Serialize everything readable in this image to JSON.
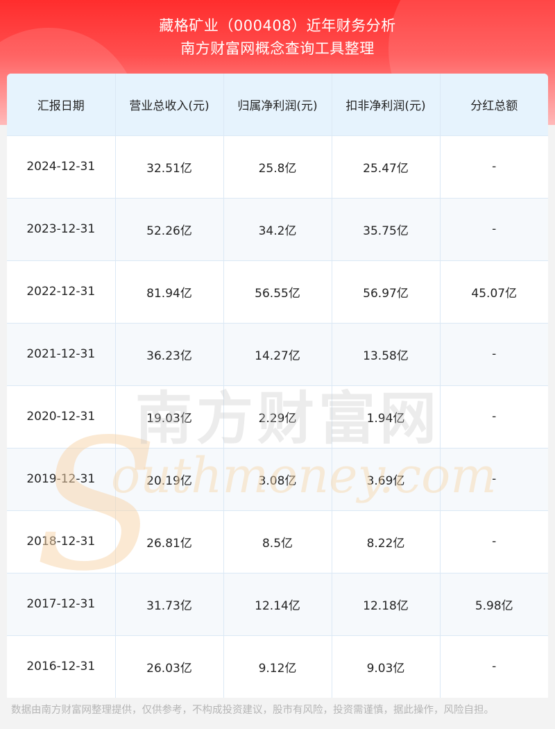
{
  "header": {
    "title_line1": "藏格矿业（000408）近年财务分析",
    "title_line2": "南方财富网概念查询工具整理"
  },
  "table": {
    "columns": [
      "汇报日期",
      "营业总收入(元)",
      "归属净利润(元)",
      "扣非净利润(元)",
      "分红总额"
    ],
    "rows": [
      [
        "2024-12-31",
        "32.51亿",
        "25.8亿",
        "25.47亿",
        "-"
      ],
      [
        "2023-12-31",
        "52.26亿",
        "34.2亿",
        "35.75亿",
        "-"
      ],
      [
        "2022-12-31",
        "81.94亿",
        "56.55亿",
        "56.97亿",
        "45.07亿"
      ],
      [
        "2021-12-31",
        "36.23亿",
        "14.27亿",
        "13.58亿",
        "-"
      ],
      [
        "2020-12-31",
        "19.03亿",
        "2.29亿",
        "1.94亿",
        "-"
      ],
      [
        "2019-12-31",
        "20.19亿",
        "3.08亿",
        "3.69亿",
        "-"
      ],
      [
        "2018-12-31",
        "26.81亿",
        "8.5亿",
        "8.22亿",
        "-"
      ],
      [
        "2017-12-31",
        "31.73亿",
        "12.14亿",
        "12.18亿",
        "5.98亿"
      ],
      [
        "2016-12-31",
        "26.03亿",
        "9.12亿",
        "9.03亿",
        "-"
      ]
    ]
  },
  "watermark": {
    "cn_text": "南方财富网",
    "en_text": "outhmoney.com",
    "logo_letter": "S"
  },
  "footer": {
    "disclaimer": "数据由南方财富网整理提供，仅供参考，不构成投资建议，股市有风险，投资需谨慎，据此操作，风险自担。"
  },
  "colors": {
    "header_red": "#ff2d2d",
    "header_bg": "#e6f3fd",
    "alt_row": "#f6f9fc",
    "border": "#dbe8f5"
  }
}
